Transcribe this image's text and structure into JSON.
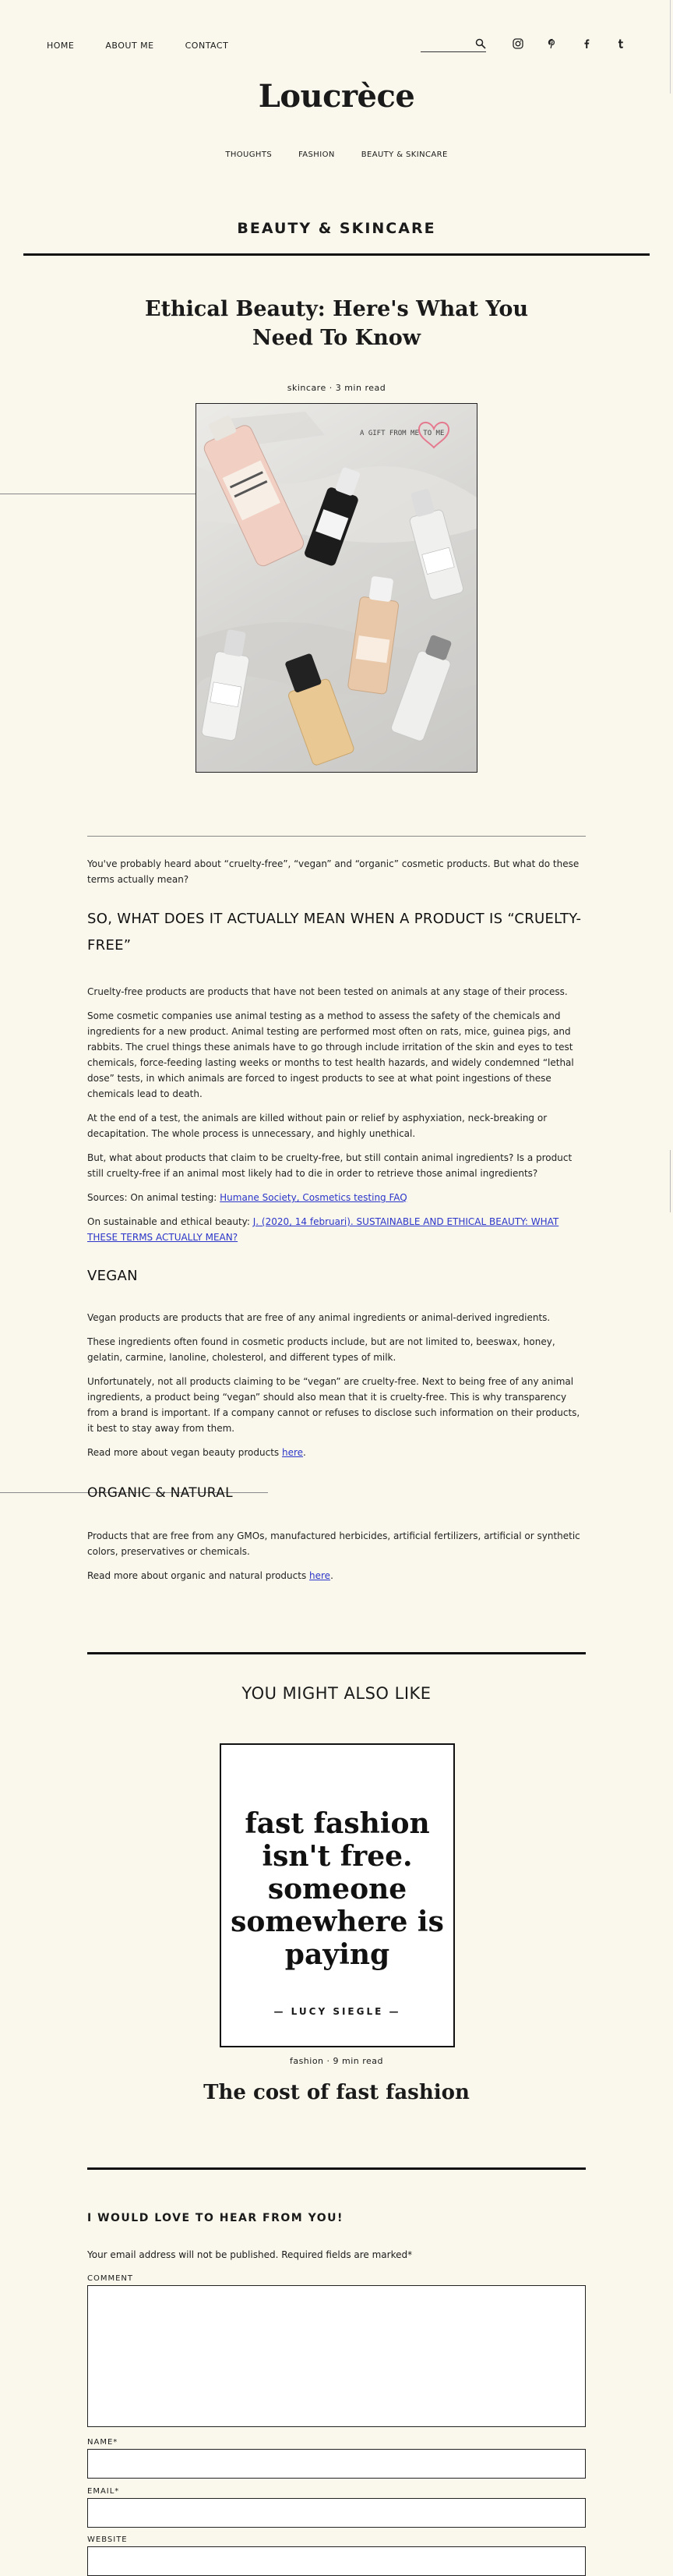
{
  "topnav": {
    "home": "HOME",
    "about": "ABOUT ME",
    "contact": "CONTACT"
  },
  "search": {
    "placeholder": ""
  },
  "social": [
    "instagram-icon",
    "pinterest-icon",
    "facebook-icon",
    "tumblr-icon"
  ],
  "site": {
    "logo": "Loucrèce"
  },
  "catnav": {
    "thoughts": "THOUGHTS",
    "fashion": "FASHION",
    "beauty": "BEAUTY & SKINCARE"
  },
  "section": {
    "title": "BEAUTY & SKINCARE"
  },
  "post": {
    "title": "Ethical Beauty: Here's What You Need To Know",
    "meta": "skincare · 3 min read",
    "image_caption": "A GIFT FROM ME TO ME"
  },
  "article": {
    "intro": "You've probably heard about “cruelty-free”, “vegan” and “organic” cosmetic products. But what do these terms actually mean?",
    "h_cruelty": "SO, WHAT DOES IT ACTUALLY MEAN WHEN A PRODUCT IS “CRUELTY-FREE”",
    "p1": "Cruelty-free products are products that have not been tested on animals at any stage of their process.",
    "p2": "Some cosmetic companies use animal testing as a method to assess the safety of the chemicals and ingredients for a new product. Animal testing are performed most often on rats, mice, guinea pigs, and rabbits. The cruel things these animals have to go through include irritation of the skin and eyes to test chemicals, force-feeding lasting weeks or months to test health hazards, and widely condemned “lethal dose” tests, in which animals are forced to ingest products to see at what point ingestions of these chemicals lead to death.",
    "p3": "At the end of a test, the animals are killed without pain or relief by asphyxiation, neck-breaking or decapitation. The whole process is unnecessary, and highly unethical.",
    "p4": "But, what about products that claim to be cruelty-free, but still contain animal ingredients? Is a product still cruelty-free if an animal most likely had to die in order to retrieve those animal ingredients?",
    "sources_label": "Sources: On animal testing: ",
    "sources_link": "Humane Society, Cosmetics testing FAQ",
    "sustain_label": "On sustainable and ethical beauty: ",
    "sustain_link": "J. (2020, 14 februari). SUSTAINABLE AND ETHICAL BEAUTY: WHAT THESE TERMS ACTUALLY MEAN?",
    "h_vegan": "VEGAN",
    "v1": "Vegan products are products that are free of any animal ingredients or animal-derived ingredients.",
    "v2": "These ingredients often found in cosmetic products include, but are not limited to, beeswax, honey, gelatin, carmine, lanoline, cholesterol, and different types of milk.",
    "v3": "Unfortunately, not all products claiming to be “vegan” are cruelty-free. Next to being free of any animal ingredients, a product being “vegan” should also mean that it is cruelty-free. This is why transparency from a brand is important. If a company cannot or refuses to disclose such information on their products, it best to stay away from them.",
    "v4_text": "Read more about vegan beauty products ",
    "v4_link": "here",
    "h_organic": "ORGANIC & NATURAL",
    "o1": "Products that are free from any GMOs, manufactured herbicides, artificial fertilizers, artificial or synthetic colors, preservatives or chemicals.",
    "o2_text": "Read more about organic and natural products ",
    "o2_link": "here"
  },
  "related": {
    "heading": "YOU MIGHT ALSO LIKE",
    "quote": "fast fashion isn't free. someone somewhere is paying",
    "quote_author": "— LUCY SIEGLE —",
    "meta": "fashion · 9 min read",
    "title": "The cost of fast fashion"
  },
  "comment_form": {
    "title": "I WOULD LOVE TO HEAR FROM YOU!",
    "note": "Your email address will not be published. Required fields are marked*",
    "comment_label": "COMMENT",
    "name_label": "NAME*",
    "email_label": "EMAIL*",
    "website_label": "WEBSITE"
  }
}
